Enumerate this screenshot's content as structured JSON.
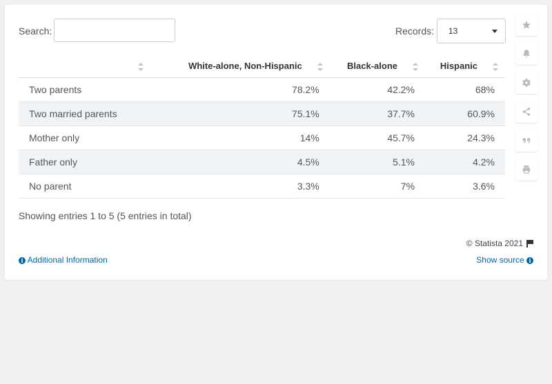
{
  "controls": {
    "search_label": "Search:",
    "search_value": "",
    "records_label": "Records:",
    "records_value": "13"
  },
  "table": {
    "columns": [
      "",
      "White-alone, Non-Hispanic",
      "Black-alone",
      "Hispanic"
    ],
    "rows": [
      [
        "Two parents",
        "78.2%",
        "42.2%",
        "68%"
      ],
      [
        "Two married parents",
        "75.1%",
        "37.7%",
        "60.9%"
      ],
      [
        "Mother only",
        "14%",
        "45.7%",
        "24.3%"
      ],
      [
        "Father only",
        "4.5%",
        "5.1%",
        "4.2%"
      ],
      [
        "No parent",
        "3.3%",
        "7%",
        "3.6%"
      ]
    ]
  },
  "footer": {
    "showing": "Showing entries 1 to 5 (5 entries in total)",
    "copyright": "© Statista 2021",
    "additional_info": "Additional Information",
    "show_source": "Show source"
  },
  "sidebar": {
    "icons": [
      "star-icon",
      "bell-icon",
      "gear-icon",
      "share-icon",
      "quote-icon",
      "print-icon"
    ]
  },
  "chart_data": {
    "type": "table",
    "columns": [
      "",
      "White-alone, Non-Hispanic",
      "Black-alone",
      "Hispanic"
    ],
    "categories": [
      "Two parents",
      "Two married parents",
      "Mother only",
      "Father only",
      "No parent"
    ],
    "series": [
      {
        "name": "White-alone, Non-Hispanic",
        "values": [
          78.2,
          75.1,
          14,
          4.5,
          3.3
        ]
      },
      {
        "name": "Black-alone",
        "values": [
          42.2,
          37.7,
          45.7,
          5.1,
          7
        ]
      },
      {
        "name": "Hispanic",
        "values": [
          68,
          60.9,
          24.3,
          4.2,
          3.6
        ]
      }
    ],
    "unit": "%"
  }
}
